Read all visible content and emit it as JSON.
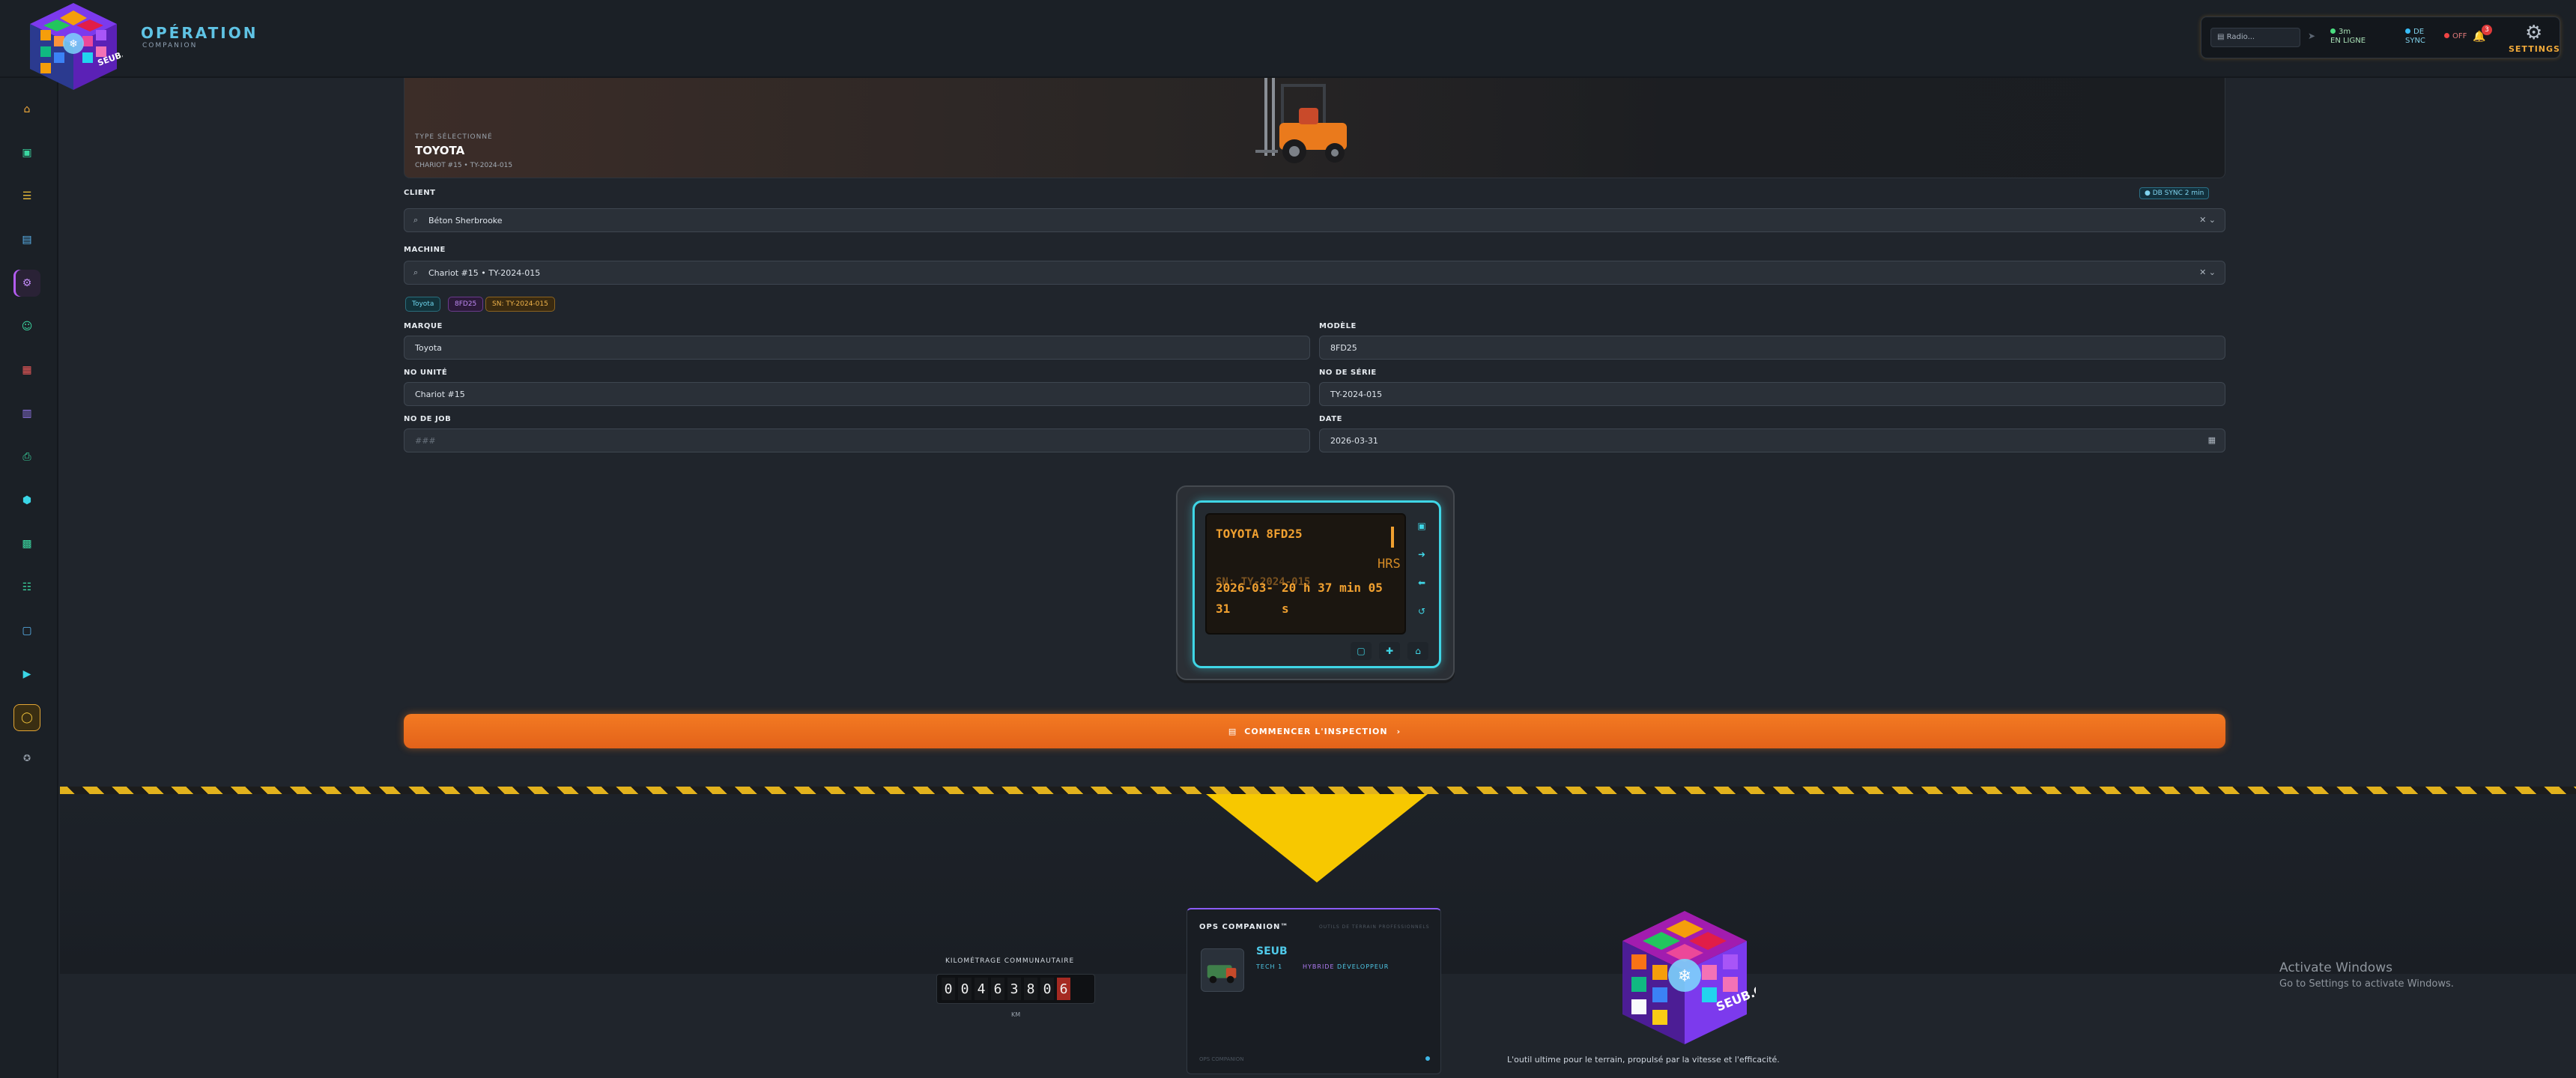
{
  "header": {
    "brand_title": "OPÉRATION",
    "brand_subtitle": "COMPANION",
    "radio_placeholder": "Radio...",
    "status_online_line1": "3m",
    "status_online_line2": "EN LIGNE",
    "status_sync_line1": "DE",
    "status_sync_line2": "SYNC",
    "status_off": "OFF",
    "notifications_count": "3",
    "settings_label": "SETTINGS"
  },
  "sidebar": {
    "icons": [
      "home-icon",
      "clipboard-icon",
      "checklist-icon",
      "document-icon",
      "forklift-icon",
      "users-icon",
      "calendar-icon",
      "chart-icon",
      "printer-icon",
      "box-icon",
      "table-icon",
      "team-icon",
      "chat-icon",
      "video-icon",
      "shield-icon",
      "gamepad-icon"
    ]
  },
  "hero": {
    "kicker": "TYPE SÉLECTIONNÉ",
    "title": "TOYOTA",
    "subtitle": "CHARIOT #15 • TY-2024-015"
  },
  "client": {
    "label": "CLIENT",
    "value": "Béton Sherbrooke",
    "sync_chip": "DB SYNC 2 min"
  },
  "machine": {
    "label": "MACHINE",
    "value": "Chariot #15 • TY-2024-015",
    "tags": [
      "Toyota",
      "8FD25",
      "SN: TY-2024-015"
    ]
  },
  "form": {
    "marque_label": "MARQUE",
    "marque_value": "Toyota",
    "modele_label": "MODÈLE",
    "modele_value": "8FD25",
    "unite_label": "NO UNITÉ",
    "unite_value": "Chariot #15",
    "serie_label": "NO DE SÉRIE",
    "serie_value": "TY-2024-015",
    "job_label": "NO DE JOB",
    "job_placeholder": "###",
    "date_label": "DATE",
    "date_value": "2026-03-31"
  },
  "display": {
    "model_line": "TOYOTA 8FD25",
    "hrs_label": "HRS",
    "ghost_line": "SN: TY-2024-015",
    "date_line1": "2026-03-",
    "date_line2": "31",
    "time_line1": "20 h 37 min 05",
    "time_line2": "s"
  },
  "cta": {
    "label": "COMMENCER L'INSPECTION"
  },
  "footer": {
    "km_label": "KILOMÉTRAGE COMMUNAUTAIRE",
    "km_digits": [
      "0",
      "0",
      "4",
      "6",
      "3",
      "8",
      "0",
      "6"
    ],
    "km_unit": "KM",
    "card_title": "OPS COMPANION™",
    "card_subtitle": "OUTILS DE TERRAIN PROFESSIONNELS",
    "card_name": "SEUB",
    "card_role": "TECH 1",
    "card_tag1": "HYBRIDE",
    "card_tag2": "DÉVELOPPEUR",
    "card_footer": "OPS COMPANION",
    "tagline": "L'outil ultime pour le terrain, propulsé par la vitesse et l'efficacité.",
    "activate_title": "Activate Windows",
    "activate_sub": "Go to Settings to activate Windows."
  },
  "colors": {
    "accent_orange": "#f37a22",
    "accent_cyan": "#3fd6e6",
    "hazard_yellow": "#f7c800",
    "brand_cyan": "#5fc3e4"
  }
}
